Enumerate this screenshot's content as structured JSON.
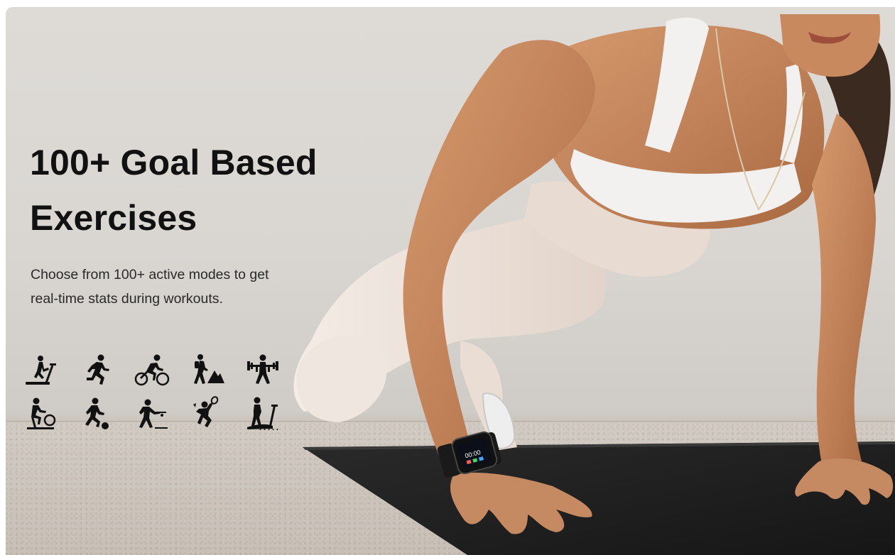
{
  "headline": {
    "line1": "100+ Goal Based",
    "line2": "Exercises"
  },
  "subtext": {
    "line1": "Choose from 100+ active modes to get",
    "line2": "real-time stats during workouts."
  },
  "more_indicator": ".....",
  "exercise_icons": [
    "treadmill-icon",
    "running-icon",
    "cycling-icon",
    "hiking-icon",
    "weightlifting-icon",
    "spinning-bike-icon",
    "soccer-icon",
    "shuffleboard-icon",
    "badminton-icon",
    "elliptical-icon"
  ],
  "colors": {
    "text": "#111111",
    "wall": "#dcd9d5",
    "mat": "#1e1e1e",
    "skin": "#c98a5e",
    "apparel": "#f2f0ee"
  }
}
